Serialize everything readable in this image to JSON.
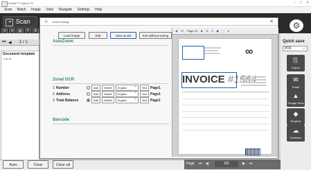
{
  "app": {
    "title": "Orpalis™ Capture XI"
  },
  "menu": [
    "Scan",
    "Batch",
    "Image",
    "View",
    "Navigate",
    "Settings",
    "Help"
  ],
  "toolbar": {
    "scan_label": "Scan",
    "small_icons": [
      "⟲",
      "⟳",
      "▤",
      "Y",
      "A",
      "C"
    ]
  },
  "left": {
    "page_indicator": "1 / 1",
    "doc_header": "Document template",
    "doc_item": "1-sp.tif"
  },
  "dialog": {
    "title": "Zonal settings",
    "load_image": "Load image",
    "edit": "Edit",
    "save_exit": "Save & exit",
    "exit_without": "Exit without saving",
    "autozoom": "AutoZoom",
    "zonal_ocr": "Zonal OCR",
    "barcode": "Barcode",
    "ocr_rows": [
      {
        "idx": "1",
        "name": "Number",
        "selected": false,
        "add": "Add",
        "delete": "Delete",
        "lang": "English",
        "type": "Text",
        "page": "Page1"
      },
      {
        "idx": "2",
        "name": "Address",
        "selected": false,
        "add": "Add",
        "delete": "Delete",
        "lang": "English",
        "type": "Text",
        "page": "Page1"
      },
      {
        "idx": "3",
        "name": "Total Balance",
        "selected": true,
        "add": "Add",
        "delete": "Delete",
        "lang": "English",
        "type": "Text",
        "page": "Page1"
      }
    ],
    "preview_page": "Page 1/1",
    "invoice_title": "INVOICE",
    "invoice_number": "#1564"
  },
  "right": {
    "quick_save": "Quick save",
    "format": "PDF",
    "buttons": [
      {
        "label": "Export",
        "icon": "⎘"
      },
      {
        "label": "Email",
        "icon": "✉"
      },
      {
        "label": "Google Drive",
        "icon": "▲"
      },
      {
        "label": "Dropbox",
        "icon": "◆"
      },
      {
        "label": "OneDrive",
        "icon": "☁"
      }
    ]
  },
  "bottom": {
    "auto": "Auto",
    "clear": "Clear",
    "clear_all": "Clear all",
    "page_label": "Page",
    "page_value": "0/0"
  }
}
